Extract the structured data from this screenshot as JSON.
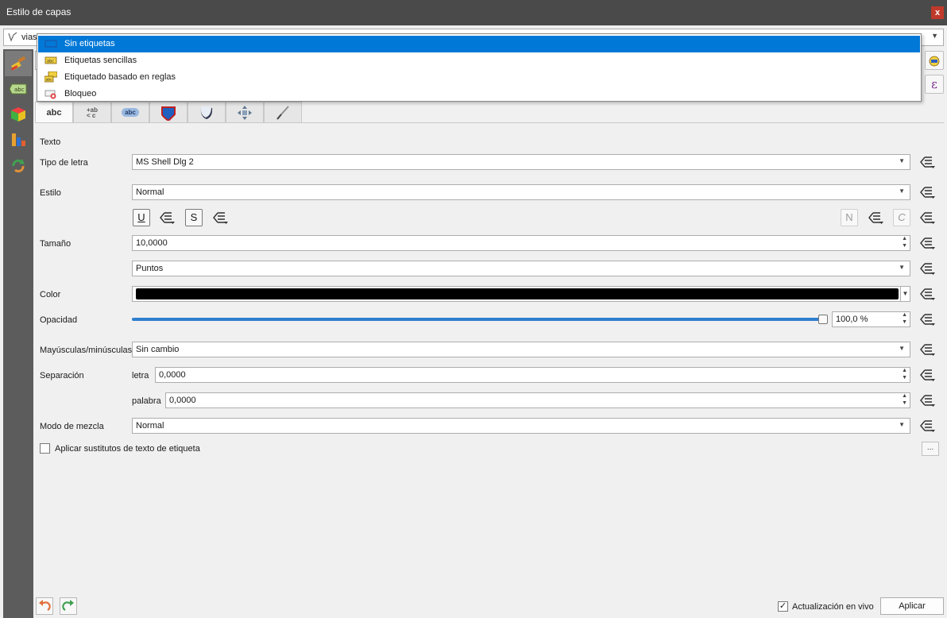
{
  "window": {
    "title": "Estilo de capas",
    "close_label": "x"
  },
  "layer_selector": {
    "value": "vias",
    "icon": "line-layer-icon"
  },
  "sidebar": {
    "items": [
      {
        "name": "symbology",
        "icon": "paintbrush-icon",
        "active": true
      },
      {
        "name": "labels",
        "icon": "abc-label-icon",
        "active": false
      },
      {
        "name": "3d-view",
        "icon": "cube-icon",
        "active": false
      },
      {
        "name": "diagrams",
        "icon": "diagram-icon",
        "active": false
      },
      {
        "name": "history",
        "icon": "history-icon",
        "active": false
      }
    ]
  },
  "label_mode": {
    "options": [
      {
        "label": "Sin etiquetas",
        "icon": "no-labels-icon",
        "selected": true
      },
      {
        "label": "Etiquetas sencillas",
        "icon": "single-labels-icon",
        "selected": false
      },
      {
        "label": "Etiquetado basado en reglas",
        "icon": "rule-based-labels-icon",
        "selected": false
      },
      {
        "label": "Bloqueo",
        "icon": "blocking-icon",
        "selected": false
      }
    ]
  },
  "right_tools": {
    "expression_symbol": "ε"
  },
  "tabs": [
    {
      "label": "abc",
      "icon": "text-tab-icon",
      "active": true
    },
    {
      "label": "+ab\n< c",
      "icon": "formatting-tab-icon",
      "active": false
    },
    {
      "label": "abc",
      "icon": "buffer-tab-icon",
      "active": false
    },
    {
      "label": "",
      "icon": "background-tab-icon",
      "active": false
    },
    {
      "label": "",
      "icon": "shadow-tab-icon",
      "active": false
    },
    {
      "label": "",
      "icon": "placement-tab-icon",
      "active": false
    },
    {
      "label": "",
      "icon": "rendering-tab-icon",
      "active": false
    }
  ],
  "text_section": {
    "heading": "Texto",
    "font_label": "Tipo de letra",
    "font_value": "MS Shell Dlg 2",
    "style_label": "Estilo",
    "style_value": "Normal",
    "underline_label": "U",
    "strikeout_label": "S",
    "bold_label": "N",
    "italic_label": "C",
    "size_label": "Tamaño",
    "size_value": "10,0000",
    "size_unit": "Puntos",
    "color_label": "Color",
    "color_value": "#000000",
    "opacity_label": "Opacidad",
    "opacity_value": "100,0 %",
    "opacity_fraction": 1.0,
    "case_label": "Mayúsculas/minúsculas",
    "case_value": "Sin cambio",
    "spacing_label": "Separación",
    "letter_label": "letra",
    "letter_value": "0,0000",
    "word_label": "palabra",
    "word_value": "0,0000",
    "blend_label": "Modo de mezcla",
    "blend_value": "Normal",
    "substitutes_label": "Aplicar sustitutos de texto de etiqueta",
    "substitutes_checked": false,
    "ellipsis_label": "..."
  },
  "footer": {
    "live_update_label": "Actualización en vivo",
    "live_update_checked": true,
    "apply_label": "Aplicar"
  }
}
